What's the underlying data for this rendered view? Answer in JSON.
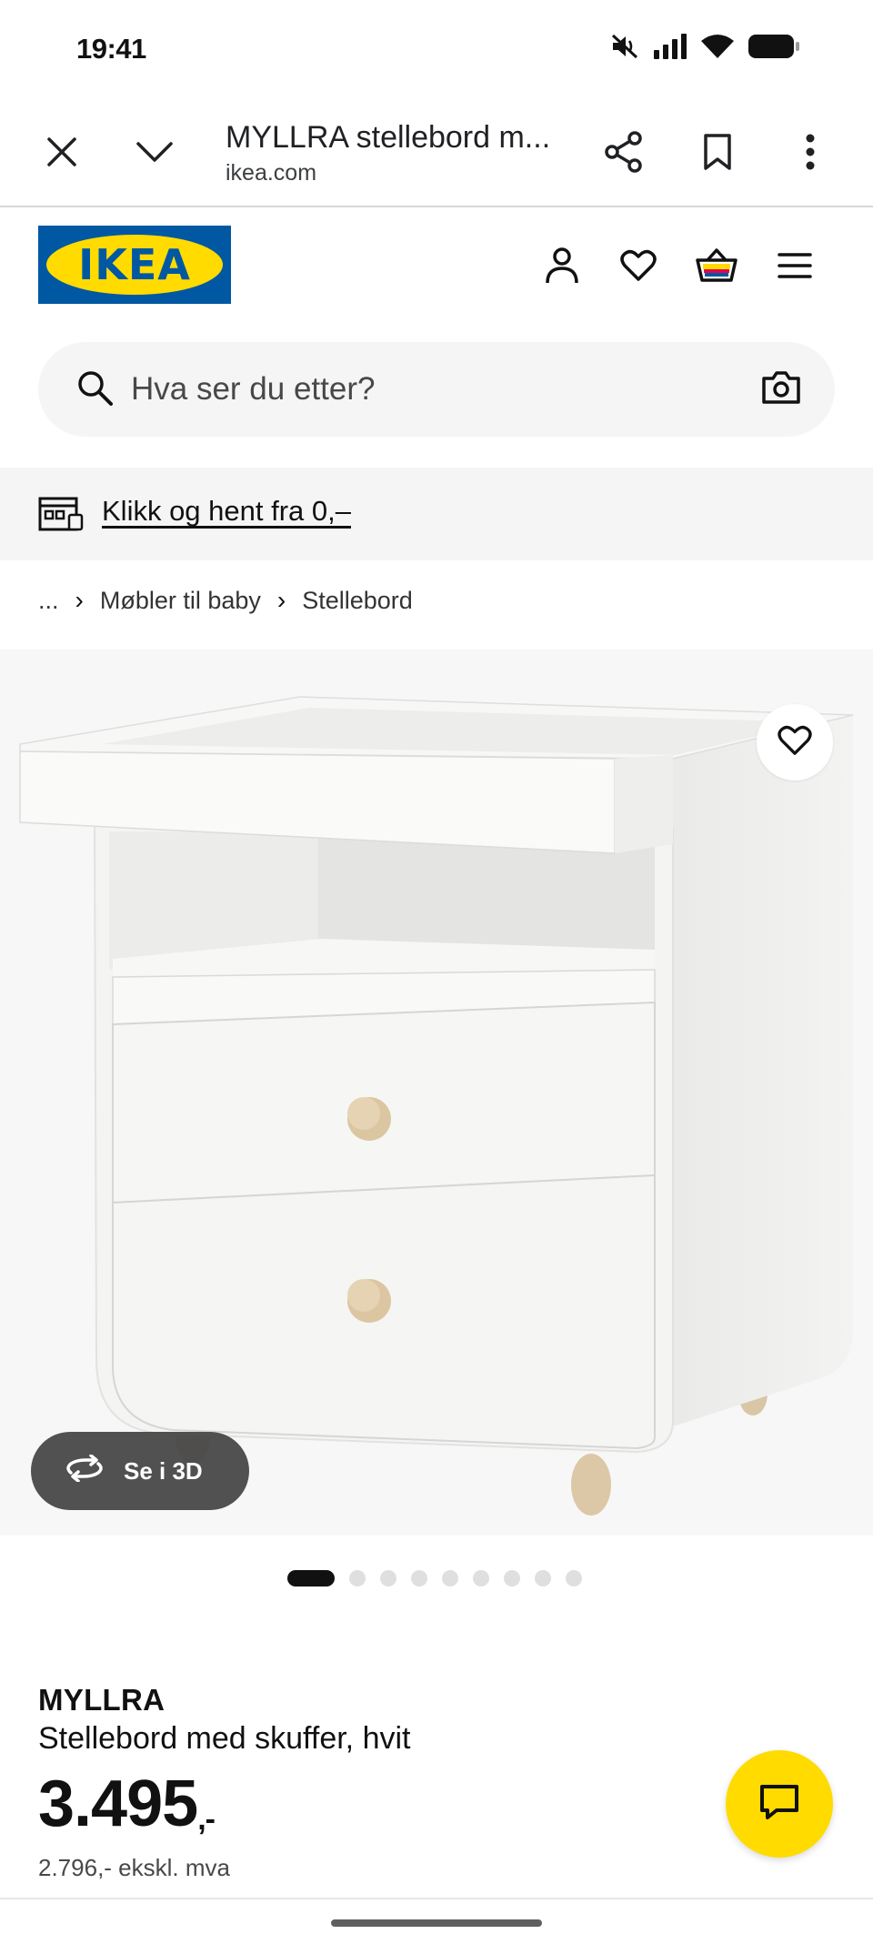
{
  "status_bar": {
    "time": "19:41",
    "icons": [
      "mute-icon",
      "signal-icon",
      "wifi-icon",
      "battery-icon"
    ]
  },
  "browser": {
    "title": "MYLLRA stellebord m...",
    "domain": "ikea.com",
    "buttons": [
      "close-icon",
      "chevron-down-icon",
      "share-icon",
      "bookmark-icon",
      "more-vert-icon"
    ]
  },
  "header": {
    "logo_text": "IKEA",
    "icons": [
      "user-icon",
      "heart-icon",
      "basket-icon",
      "menu-icon"
    ]
  },
  "search": {
    "placeholder": "Hva ser du etter?"
  },
  "promo": {
    "link_text": "Klikk og hent fra 0,–"
  },
  "breadcrumb": {
    "items": [
      "...",
      "Møbler til baby",
      "Stellebord"
    ]
  },
  "product_image": {
    "view3d_label": "Se i 3D",
    "carousel_count": 9,
    "carousel_active": 1
  },
  "product": {
    "brand": "MYLLRA",
    "description": "Stellebord med skuffer, hvit",
    "price": "3.495",
    "price_suffix": ",-",
    "price_ex_vat": "2.796,- ekskl. mva"
  },
  "colors": {
    "ikea_blue": "#0058a3",
    "ikea_yellow": "#ffdb00",
    "text": "#111111"
  }
}
